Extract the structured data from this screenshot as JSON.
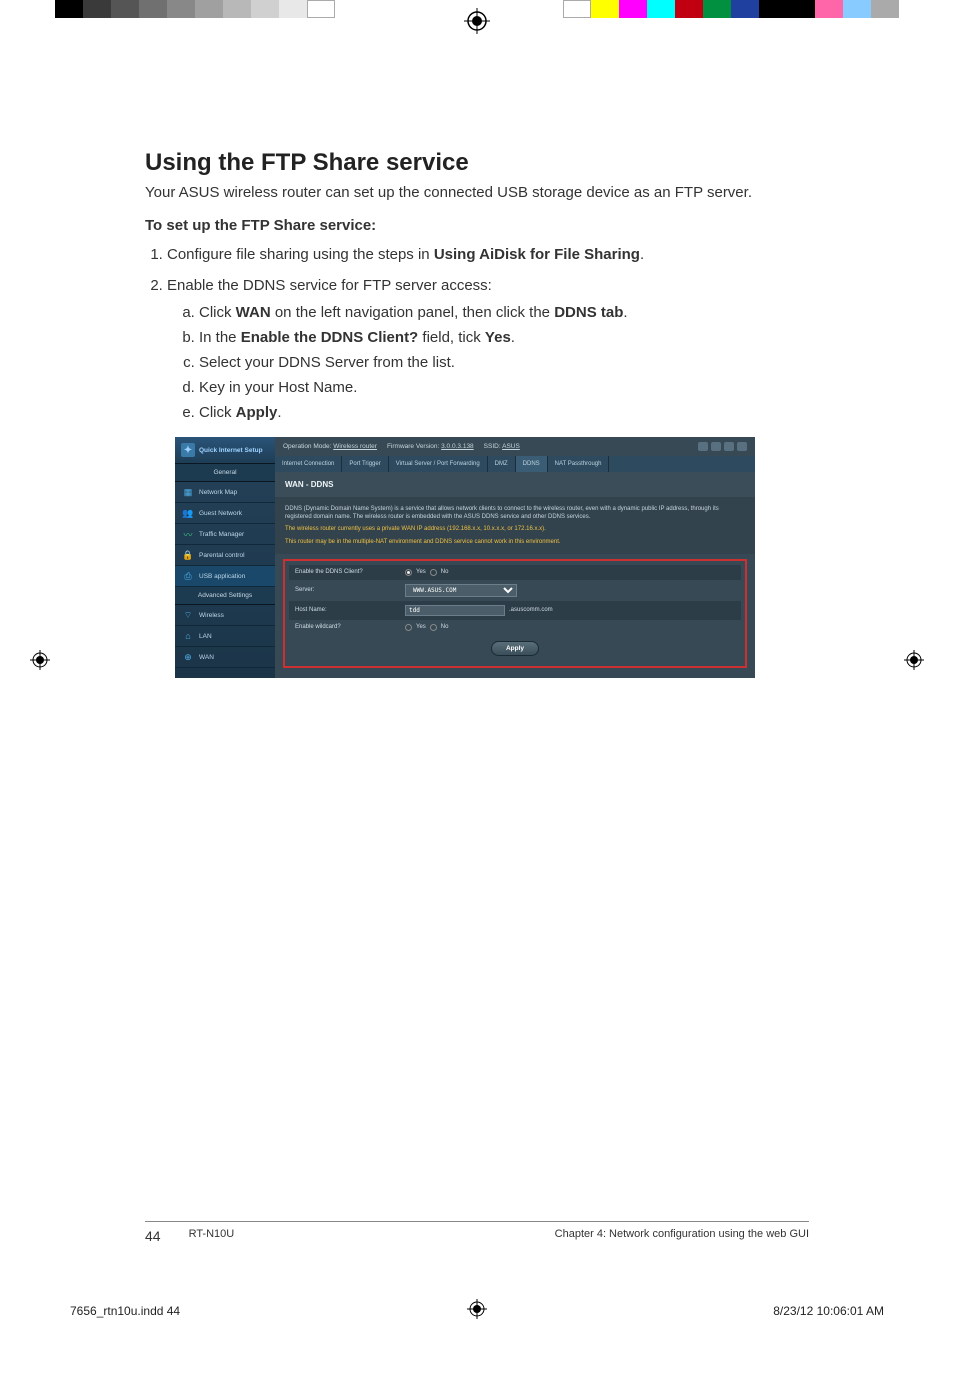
{
  "heading": "Using the FTP Share service",
  "intro": "Your ASUS wireless router can set up the connected USB storage device as an FTP server.",
  "subhead": "To set up the FTP Share service:",
  "step1_pre": "Configure file sharing using the steps in ",
  "step1_bold": "Using AiDisk for File Sharing",
  "step1_post": ".",
  "step2": "Enable the DDNS service for FTP server access:",
  "s2a_pre": "Click ",
  "s2a_b1": "WAN",
  "s2a_mid": " on the left navigation panel, then click the ",
  "s2a_b2": "DDNS tab",
  "s2a_post": ".",
  "s2b_pre": "In the ",
  "s2b_b1": "Enable the DDNS Client?",
  "s2b_mid": " field, tick ",
  "s2b_b2": "Yes",
  "s2b_post": ".",
  "s2c": "Select your DDNS Server from the list.",
  "s2d": "Key in your Host Name.",
  "s2e_pre": "Click ",
  "s2e_b": "Apply",
  "s2e_post": ".",
  "router": {
    "qis": "Quick Internet Setup",
    "sec_general": "General",
    "sec_advanced": "Advanced Settings",
    "nav": {
      "network_map": "Network Map",
      "guest_network": "Guest Network",
      "traffic_manager": "Traffic Manager",
      "parental_control": "Parental control",
      "usb_application": "USB application",
      "wireless": "Wireless",
      "lan": "LAN",
      "wan": "WAN"
    },
    "top": {
      "op_mode_lbl": "Operation Mode:",
      "op_mode_val": "Wireless router",
      "fw_lbl": "Firmware Version:",
      "fw_val": "3.0.0.3.138",
      "ssid_lbl": "SSID:",
      "ssid_val": "ASUS"
    },
    "tabs": {
      "internet_connection": "Internet Connection",
      "port_trigger": "Port Trigger",
      "virtual_server": "Virtual Server / Port Forwarding",
      "dmz": "DMZ",
      "ddns": "DDNS",
      "nat_passthrough": "NAT Passthrough"
    },
    "panel_title": "WAN - DDNS",
    "desc1": "DDNS (Dynamic Domain Name System) is a service that allows network clients to connect to the wireless router, even with a dynamic public IP address, through its registered domain name. The wireless router is embedded with the ASUS DDNS service and other DDNS services.",
    "desc2a": "The wireless router currently uses a private WAN IP address (192.168.x.x, 10.x.x.x, or 172.16.x.x).",
    "desc2b": "This router may be in the multiple-NAT environment and DDNS service cannot work in this environment.",
    "form": {
      "enable_client_lbl": "Enable the DDNS Client?",
      "server_lbl": "Server:",
      "server_val": "WWW.ASUS.COM",
      "hostname_lbl": "Host Name:",
      "hostname_val": "tdd",
      "hostname_suffix": ".asuscomm.com",
      "wildcard_lbl": "Enable wildcard?",
      "yes": "Yes",
      "no": "No",
      "apply": "Apply"
    }
  },
  "footer": {
    "pagenum": "44",
    "model": "RT-N10U",
    "chapter": "Chapter 4: Network configuration using the web GUI"
  },
  "printfoot": {
    "file": "7656_rtn10u.indd   44",
    "datetime": "8/23/12   10:06:01 AM"
  }
}
